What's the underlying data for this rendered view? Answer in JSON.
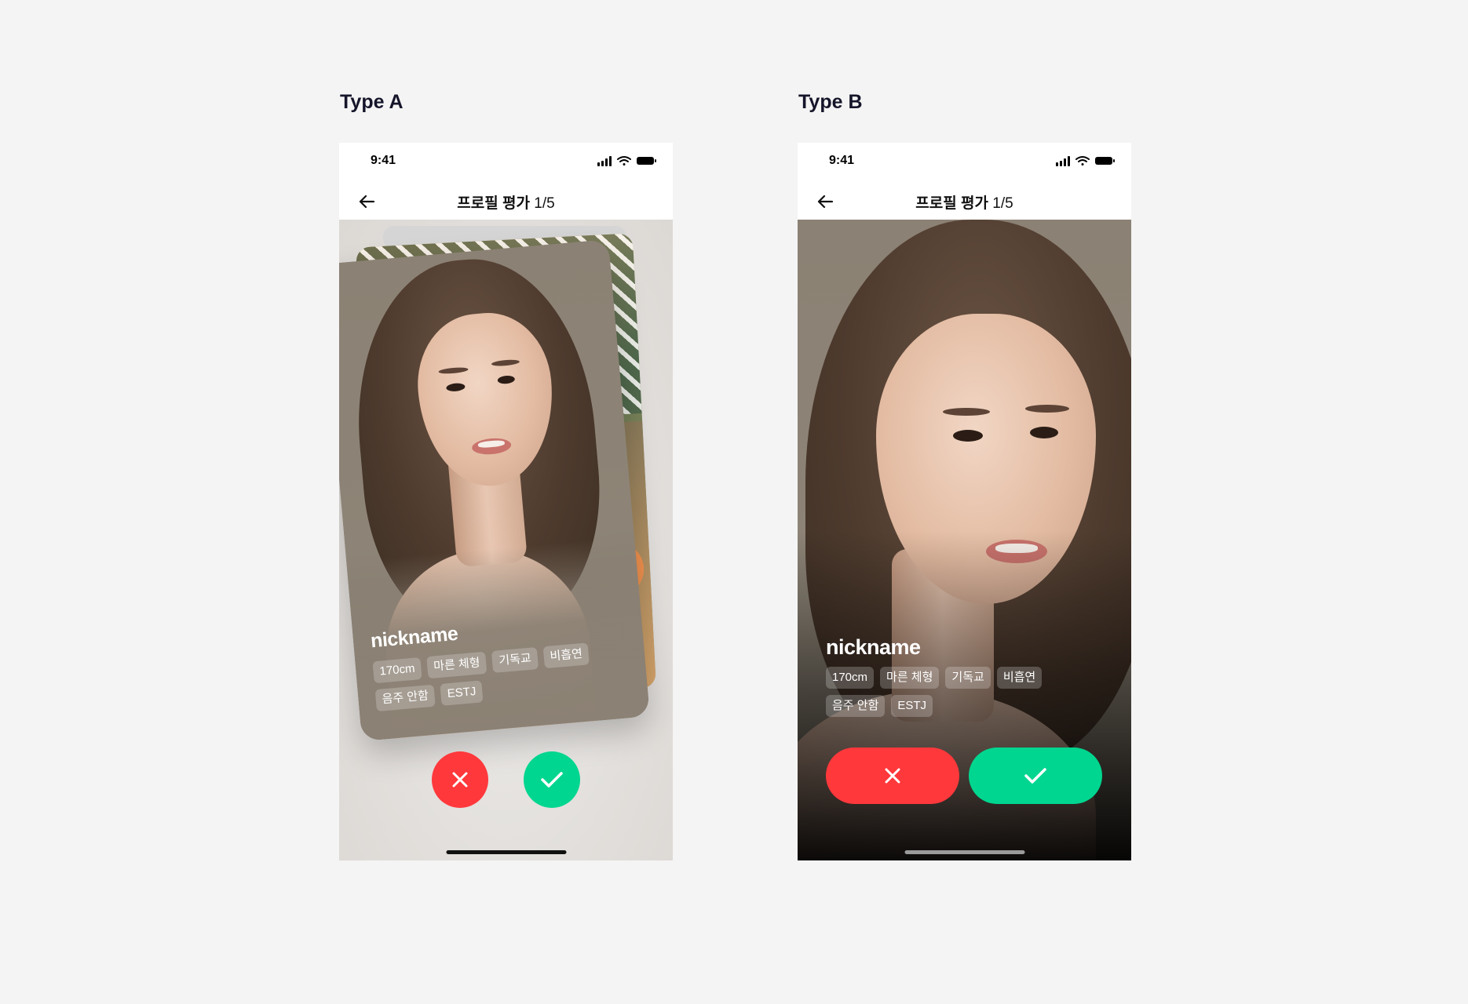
{
  "typeA": {
    "label": "Type A",
    "status": {
      "time": "9:41"
    },
    "nav": {
      "title_bold": "프로필 평가",
      "title_count": "1/5"
    },
    "profile": {
      "nickname": "nickname",
      "tags": [
        "170cm",
        "마른 체형",
        "기독교",
        "비흡연",
        "음주 안함",
        "ESTJ"
      ]
    }
  },
  "typeB": {
    "label": "Type B",
    "status": {
      "time": "9:41"
    },
    "nav": {
      "title_bold": "프로필 평가",
      "title_count": "1/5"
    },
    "profile": {
      "nickname": "nickname",
      "tags": [
        "170cm",
        "마른 체형",
        "기독교",
        "비흡연",
        "음주 안함",
        "ESTJ"
      ]
    }
  },
  "colors": {
    "reject": "#ff383c",
    "accept": "#00d68f",
    "background": "#f4f4f4"
  },
  "icons": {
    "reject": "close-icon",
    "accept": "check-icon",
    "back": "arrow-left-icon"
  }
}
